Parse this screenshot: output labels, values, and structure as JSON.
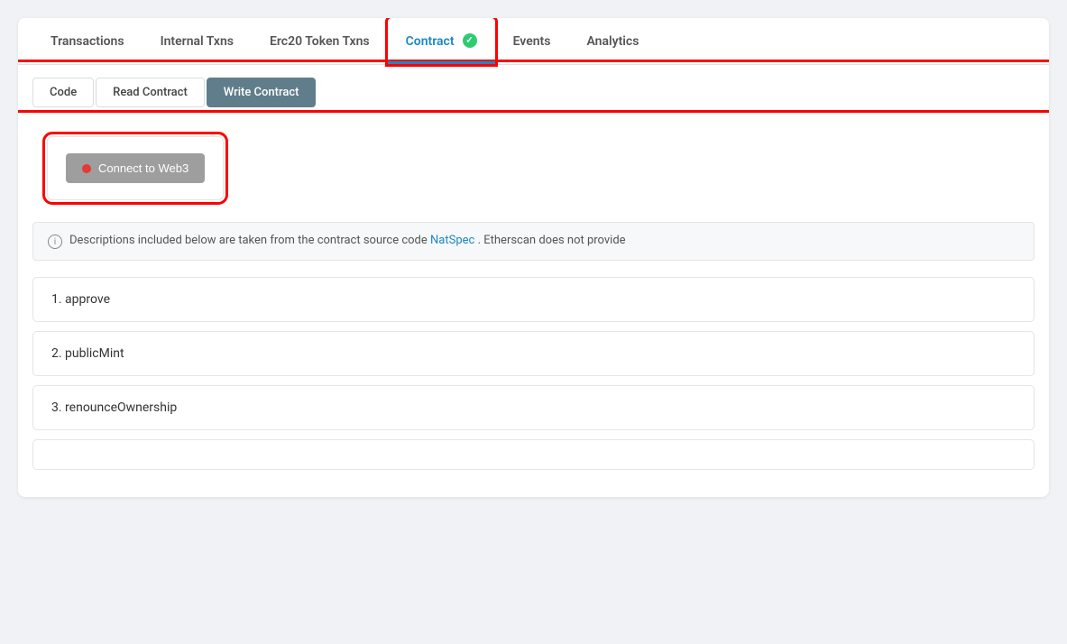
{
  "tabs": [
    {
      "id": "transactions",
      "label": "Transactions",
      "active": false,
      "highlighted": false
    },
    {
      "id": "internal-txns",
      "label": "Internal Txns",
      "active": false,
      "highlighted": false
    },
    {
      "id": "erc20-token-txns",
      "label": "Erc20 Token Txns",
      "active": false,
      "highlighted": false
    },
    {
      "id": "contract",
      "label": "Contract",
      "active": true,
      "highlighted": true,
      "verified": true
    },
    {
      "id": "events",
      "label": "Events",
      "active": false,
      "highlighted": false
    },
    {
      "id": "analytics",
      "label": "Analytics",
      "active": false,
      "highlighted": false
    }
  ],
  "sub_tabs": [
    {
      "id": "code",
      "label": "Code",
      "active": false
    },
    {
      "id": "read-contract",
      "label": "Read Contract",
      "active": false
    },
    {
      "id": "write-contract",
      "label": "Write Contract",
      "active": true
    }
  ],
  "connect_button": {
    "label": "Connect to Web3"
  },
  "info_notice": {
    "text_before": "Descriptions included below are taken from the contract source code",
    "link_text": "NatSpec",
    "text_after": ". Etherscan does not provide"
  },
  "contract_functions": [
    {
      "index": 1,
      "name": "approve"
    },
    {
      "index": 2,
      "name": "publicMint"
    },
    {
      "index": 3,
      "name": "renounceOwnership"
    }
  ]
}
